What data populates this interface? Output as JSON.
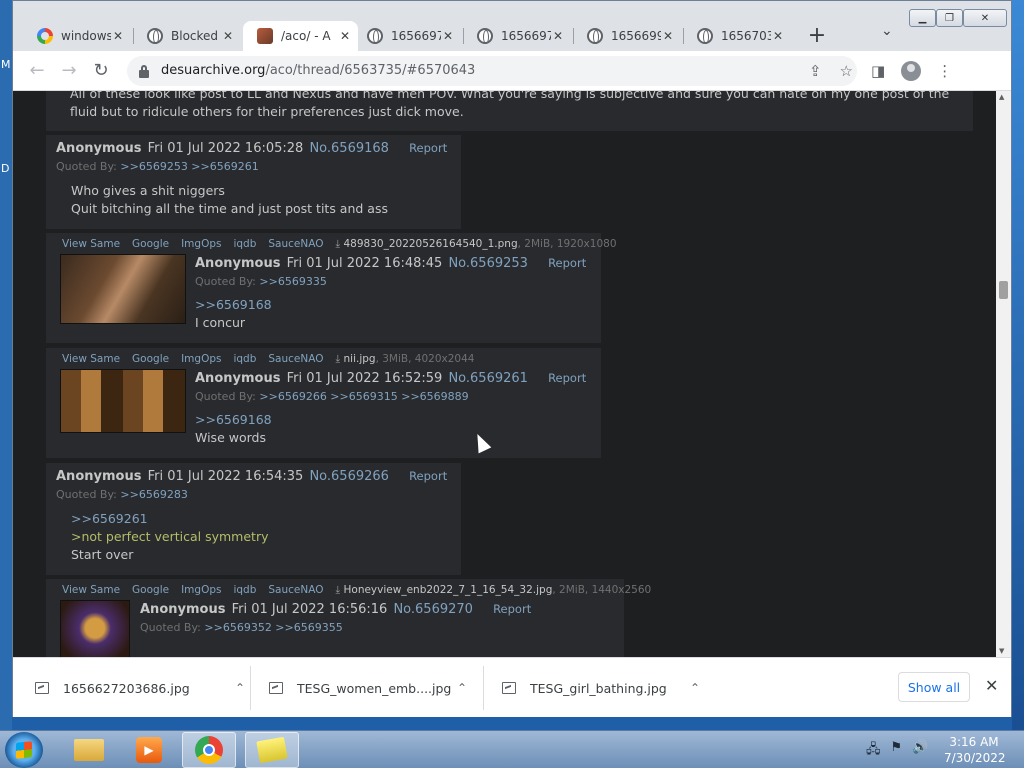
{
  "desktop": {
    "left_glyphs": [
      "M",
      "D"
    ]
  },
  "tabs": [
    {
      "title": "windows",
      "icon": "google-icon",
      "active": false
    },
    {
      "title": "Blocked",
      "icon": "globe-icon",
      "active": false
    },
    {
      "title": "/aco/ - A",
      "icon": "aco-favicon",
      "active": true
    },
    {
      "title": "1656697",
      "icon": "globe-icon",
      "active": false
    },
    {
      "title": "1656697",
      "icon": "globe-icon",
      "active": false
    },
    {
      "title": "1656699",
      "icon": "globe-icon",
      "active": false
    },
    {
      "title": "1656703",
      "icon": "globe-icon",
      "active": false
    }
  ],
  "address": {
    "host": "desuarchive.org",
    "path": "/aco/thread/6563735/#6570643"
  },
  "top_post_text": "All of these look like post to LL and Nexus and have men POV. What you're saying is subjective and sure you can hate on my one post of the fluid but to ridicule others for their preferences just dick move.",
  "file_links": [
    "View Same",
    "Google",
    "ImgOps",
    "iqdb",
    "SauceNAO"
  ],
  "report_label": "Report",
  "quoted_by_label": "Quoted By:",
  "posts": [
    {
      "name": "Anonymous",
      "date": "Fri 01 Jul 2022 16:05:28",
      "no": "No.6569168",
      "quoted_by": ">>6569253 >>6569261",
      "lines": [
        "Who gives a shit niggers",
        "Quit bitching all the time and just post tits and ass"
      ]
    },
    {
      "name": "Anonymous",
      "date": "Fri 01 Jul 2022 16:48:45",
      "no": "No.6569253",
      "file_name": "489830_20220526164540_1.png",
      "file_info": ", 2MiB, 1920x1080",
      "quoted_by": ">>6569335",
      "quote": ">>6569168",
      "lines": [
        "I concur"
      ]
    },
    {
      "name": "Anonymous",
      "date": "Fri 01 Jul 2022 16:52:59",
      "no": "No.6569261",
      "file_name": "nii.jpg",
      "file_info": ", 3MiB, 4020x2044",
      "quoted_by": ">>6569266 >>6569315 >>6569889",
      "quote": ">>6569168",
      "lines": [
        "Wise words"
      ]
    },
    {
      "name": "Anonymous",
      "date": "Fri 01 Jul 2022 16:54:35",
      "no": "No.6569266",
      "quoted_by": ">>6569283",
      "quote": ">>6569261",
      "greentext": ">not perfect vertical symmetry",
      "lines": [
        "Start over"
      ]
    },
    {
      "name": "Anonymous",
      "date": "Fri 01 Jul 2022 16:56:16",
      "no": "No.6569270",
      "file_name": "Honeyview_enb2022_7_1_16_54_32.jpg",
      "file_info": ", 2MiB, 1440x2560",
      "quoted_by": ">>6569352 >>6569355"
    }
  ],
  "downloads": [
    {
      "name": "1656627203686.jpg"
    },
    {
      "name": "TESG_women_emb....jpg"
    },
    {
      "name": "TESG_girl_bathing.jpg"
    }
  ],
  "show_all_label": "Show all",
  "clock": {
    "time": "3:16 AM",
    "date": "7/30/2022"
  }
}
